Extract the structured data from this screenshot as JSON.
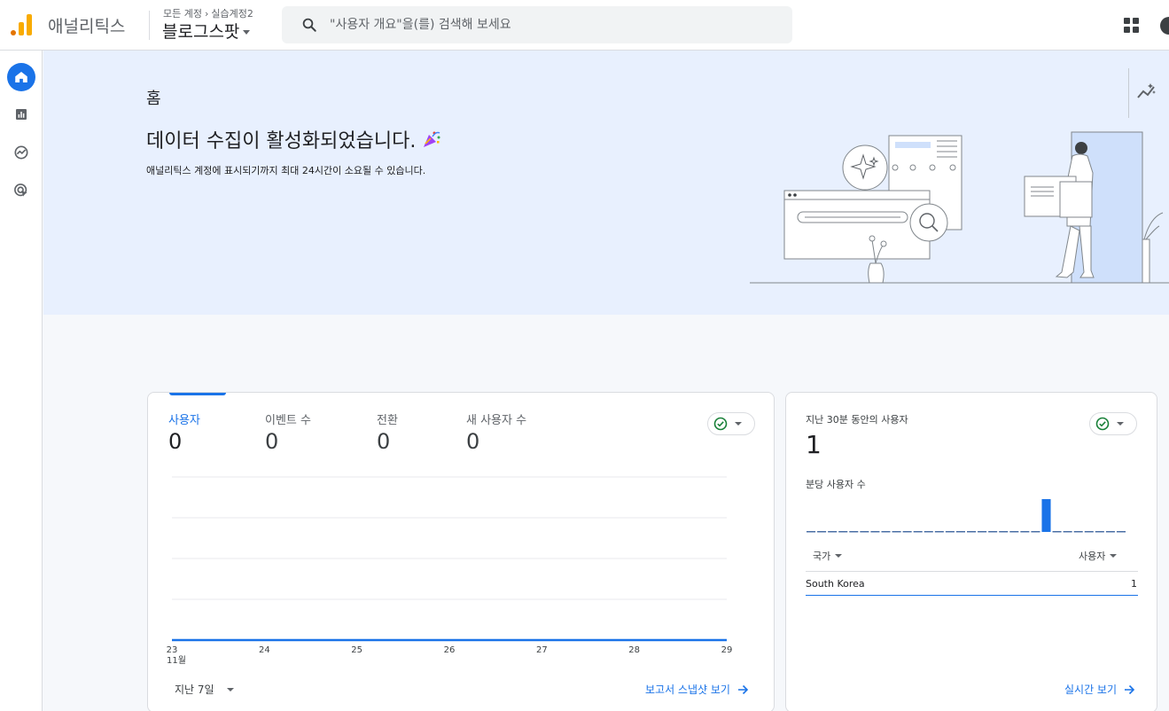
{
  "header": {
    "app_name": "애널리틱스",
    "breadcrumb": {
      "parent": "모든 계정",
      "account": "실습계정2"
    },
    "property": "블로그스팟",
    "search_placeholder": "\"사용자 개요\"을(를) 검색해 보세요"
  },
  "colors": {
    "brand_orange": "#f9ab00",
    "brand_dark_orange": "#e37400",
    "accent_blue": "#1a73e8",
    "hero_bg": "#e8f0fe",
    "success_green": "#188038"
  },
  "nav": {
    "items": [
      {
        "name": "home",
        "icon": "home-icon",
        "active": true
      },
      {
        "name": "reports",
        "icon": "bar-chart-icon",
        "active": false
      },
      {
        "name": "explore",
        "icon": "explore-icon",
        "active": false
      },
      {
        "name": "advertising",
        "icon": "advertising-icon",
        "active": false
      }
    ]
  },
  "hero": {
    "title": "홈",
    "heading": "데이터 수집이 활성화되었습니다.",
    "heading_icon": "party-popper-icon",
    "subtitle": "애널리틱스 계정에 표시되기까지 최대 24시간이 소요될 수 있습니다."
  },
  "overview_card": {
    "metrics": [
      {
        "label": "사용자",
        "value": "0",
        "active": true
      },
      {
        "label": "이벤트 수",
        "value": "0",
        "active": false
      },
      {
        "label": "전환",
        "value": "0",
        "active": false
      },
      {
        "label": "새 사용자 수",
        "value": "0",
        "active": false
      }
    ],
    "date_range": "지난 7일",
    "link_label": "보고서 스냅샷 보기"
  },
  "chart_data": {
    "type": "line",
    "x": [
      "23",
      "24",
      "25",
      "26",
      "27",
      "28",
      "29"
    ],
    "x_sublabel": "11월",
    "series": [
      {
        "values": [
          0,
          0,
          0,
          0,
          0,
          0,
          0
        ]
      }
    ],
    "ylim": [
      0,
      4
    ],
    "grid": true
  },
  "realtime_card": {
    "label": "지난 30분 동안의 사용자",
    "value": "1",
    "sub_label": "분당 사용자 수",
    "per_minute": [
      0,
      0,
      0,
      0,
      0,
      0,
      0,
      0,
      0,
      0,
      0,
      0,
      0,
      0,
      0,
      0,
      0,
      0,
      0,
      0,
      0,
      0,
      1,
      0,
      0,
      0,
      0,
      0,
      0,
      0
    ],
    "table": {
      "col_country": "국가",
      "col_users": "사용자",
      "rows": [
        {
          "country": "South Korea",
          "users": "1"
        }
      ]
    },
    "link_label": "실시간 보기"
  }
}
